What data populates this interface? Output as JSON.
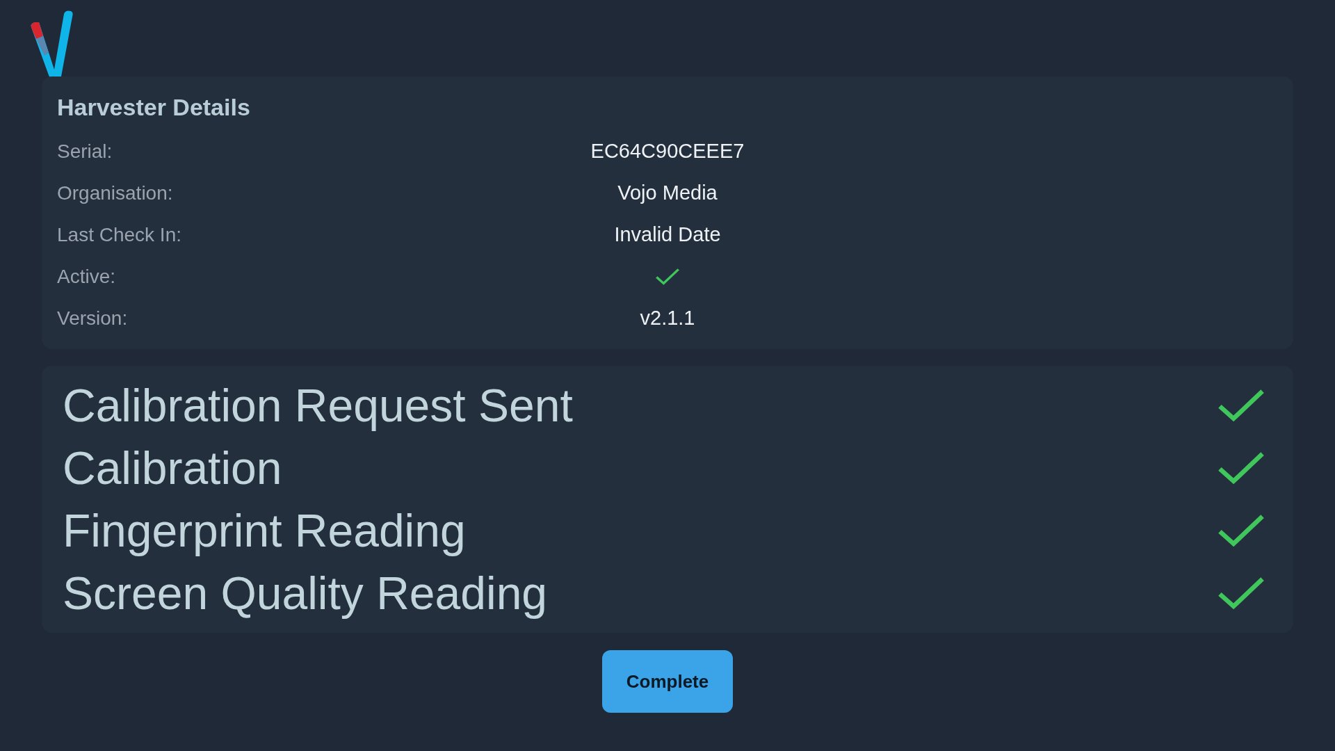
{
  "details": {
    "title": "Harvester Details",
    "rows": [
      {
        "kind": "text",
        "label": "Serial:",
        "value": "EC64C90CEEE7"
      },
      {
        "kind": "text",
        "label": "Organisation:",
        "value": "Vojo Media"
      },
      {
        "kind": "text",
        "label": "Last Check In:",
        "value": "Invalid Date"
      },
      {
        "kind": "flag",
        "label": "Active:",
        "on": true
      },
      {
        "kind": "text",
        "label": "Version:",
        "value": "v2.1.1"
      }
    ]
  },
  "steps": [
    {
      "label": "Calibration Request Sent",
      "done": true
    },
    {
      "label": "Calibration",
      "done": true
    },
    {
      "label": "Fingerprint Reading",
      "done": true
    },
    {
      "label": "Screen Quality Reading",
      "done": true
    }
  ],
  "button": "Complete"
}
